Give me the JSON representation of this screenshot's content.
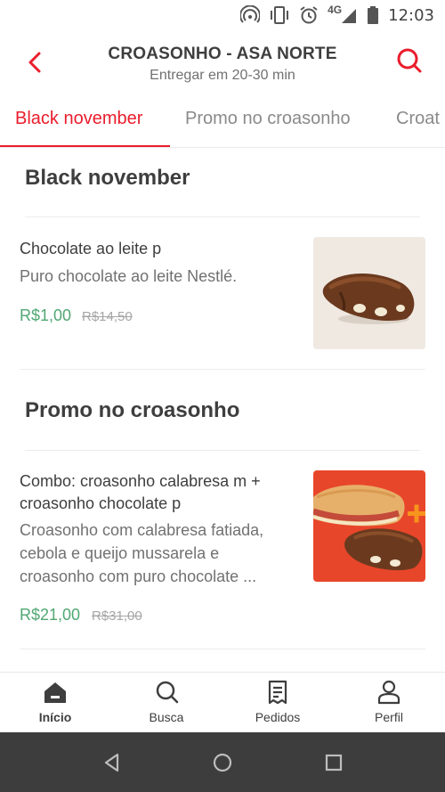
{
  "status_bar": {
    "time": "12:03",
    "network": "4G"
  },
  "header": {
    "title": "CROASONHO - ASA NORTE",
    "subtitle": "Entregar em 20-30 min"
  },
  "tabs": [
    {
      "label": "Black november",
      "active": true
    },
    {
      "label": "Promo no croasonho",
      "active": false
    },
    {
      "label": "Croat",
      "active": false
    }
  ],
  "sections": [
    {
      "title": "Black november",
      "items": [
        {
          "name": "Chocolate ao leite p",
          "description": "Puro chocolate ao leite Nestlé.",
          "price": "R$1,00",
          "old_price": "R$14,50"
        }
      ]
    },
    {
      "title": "Promo no croasonho",
      "items": [
        {
          "name_line1": "Combo: croasonho calabresa m +",
          "name_line2": "croasonho chocolate p",
          "desc_line1": "Croasonho com calabresa fatiada,",
          "desc_line2": "cebola e queijo mussarela e",
          "desc_line3": "croasonho com puro chocolate ...",
          "price": "R$21,00",
          "old_price": "R$31,00"
        }
      ]
    }
  ],
  "bottom_nav": [
    {
      "label": "Início",
      "icon": "home-icon",
      "active": true
    },
    {
      "label": "Busca",
      "icon": "search-icon",
      "active": false
    },
    {
      "label": "Pedidos",
      "icon": "orders-icon",
      "active": false
    },
    {
      "label": "Perfil",
      "icon": "profile-icon",
      "active": false
    }
  ],
  "colors": {
    "accent": "#ea1d2c",
    "price": "#50a773",
    "android_nav": "#3d3d3d"
  }
}
